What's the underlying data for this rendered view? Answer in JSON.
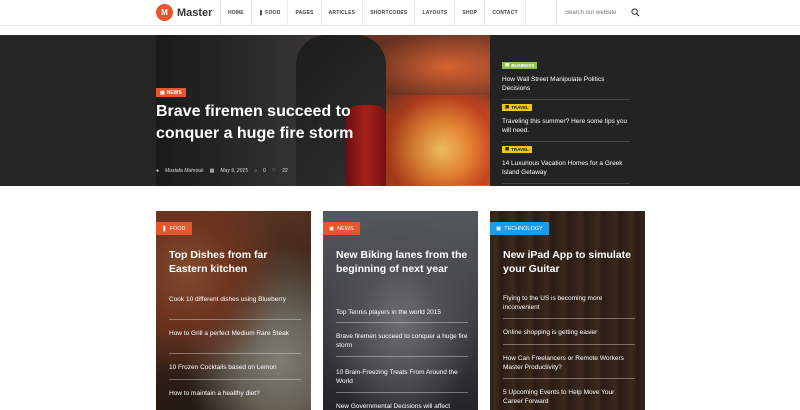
{
  "header": {
    "logo_mark": "M",
    "logo_text": "Master",
    "nav": [
      "HOME",
      "FOOD",
      "PAGES",
      "ARTICLES",
      "SHORTCODES",
      "LAYOUTS",
      "SHOP",
      "CONTACT"
    ],
    "search_placeholder": "Search our website"
  },
  "hero": {
    "category": "NEWS",
    "title": "Brave firemen succeed to conquer a huge fire storm",
    "author": "Mostafa Mahrouk",
    "date": "May 9, 2015",
    "comments": "0",
    "likes": "22",
    "side": [
      {
        "category": "BUSINESS",
        "title": "How Wall Street Manipulate Politics Decisions",
        "badge_color": "#8bc34a"
      },
      {
        "category": "TRAVEL",
        "title": "Traveling this summer? Here some tips you will need.",
        "badge_color": "#f3c613"
      },
      {
        "category": "TRAVEL",
        "title": "14 Luxurious Vacation Homes for a Greek Island Getaway",
        "badge_color": "#f3c613"
      }
    ]
  },
  "cards": [
    {
      "category": "FOOD",
      "accent": "#e8562d",
      "title": "Top Dishes from far Eastern kitchen",
      "items": [
        "Cook 10 different dishes using Blueberry",
        "How to Grill a perfect Medium Rare Steak",
        "10 Frozen Cocktails based on Lemon",
        "How to maintain a healthy diet?"
      ]
    },
    {
      "category": "NEWS",
      "accent": "#e8562d",
      "title": "New Biking lanes from the beginning of next year",
      "items": [
        "Top Tennis players in the world 2015",
        "Brave firemen succeed to conquer a huge fire storm",
        "10 Brain-Freezing Treats From Around the World",
        "New Governmental Decisions will affect"
      ]
    },
    {
      "category": "TECHNOLOGY",
      "accent": "#1e9be8",
      "title": "New iPad App to simulate your Guitar",
      "items": [
        "Flying to the US is becoming more inconvenient",
        "Online shopping is getting easier",
        "How Can Freelancers or Remote Workers Master Productivity?",
        "5 Upcoming Events to Help Move Your Career Forward"
      ]
    }
  ]
}
